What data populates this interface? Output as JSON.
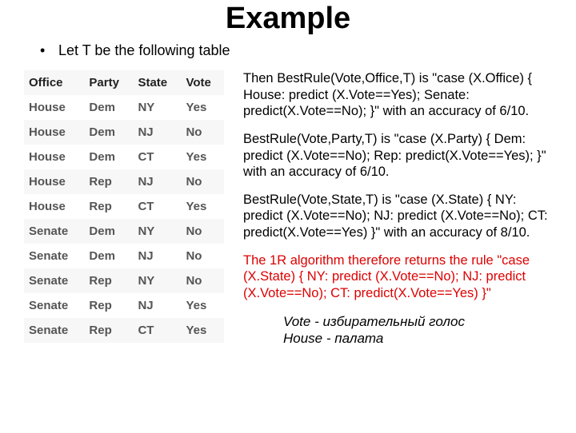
{
  "title": "Example",
  "intro_bullet": "•",
  "intro_text": "Let T be the following table",
  "table": {
    "headers": [
      "Office",
      "Party",
      "State",
      "Vote"
    ],
    "rows": [
      [
        "House",
        "Dem",
        "NY",
        "Yes"
      ],
      [
        "House",
        "Dem",
        "NJ",
        "No"
      ],
      [
        "House",
        "Dem",
        "CT",
        "Yes"
      ],
      [
        "House",
        "Rep",
        "NJ",
        "No"
      ],
      [
        "House",
        "Rep",
        "CT",
        "Yes"
      ],
      [
        "Senate",
        "Dem",
        "NY",
        "No"
      ],
      [
        "Senate",
        "Dem",
        "NJ",
        "No"
      ],
      [
        "Senate",
        "Rep",
        "NY",
        "No"
      ],
      [
        "Senate",
        "Rep",
        "NJ",
        "Yes"
      ],
      [
        "Senate",
        "Rep",
        "CT",
        "Yes"
      ]
    ]
  },
  "para1": "Then BestRule(Vote,Office,T) is \"case (X.Office) { House: predict (X.Vote==Yes); Senate: predict(X.Vote==No); }\" with an accuracy of 6/10.",
  "para2": "BestRule(Vote,Party,T) is \"case (X.Party) { Dem: predict (X.Vote==No); Rep: predict(X.Vote==Yes); }\" with an accuracy of 6/10.",
  "para3": "BestRule(Vote,State,T) is \"case (X.State) { NY: predict (X.Vote==No); NJ: predict (X.Vote==No); CT: predict(X.Vote==Yes) }\" with an accuracy of 8/10.",
  "para4": "The 1R algorithm therefore returns the rule \"case (X.State) { NY: predict (X.Vote==No); NJ: predict (X.Vote==No); CT: predict(X.Vote==Yes) }\"",
  "gloss1": "Vote - избирательный голос",
  "gloss2": "House - палата"
}
